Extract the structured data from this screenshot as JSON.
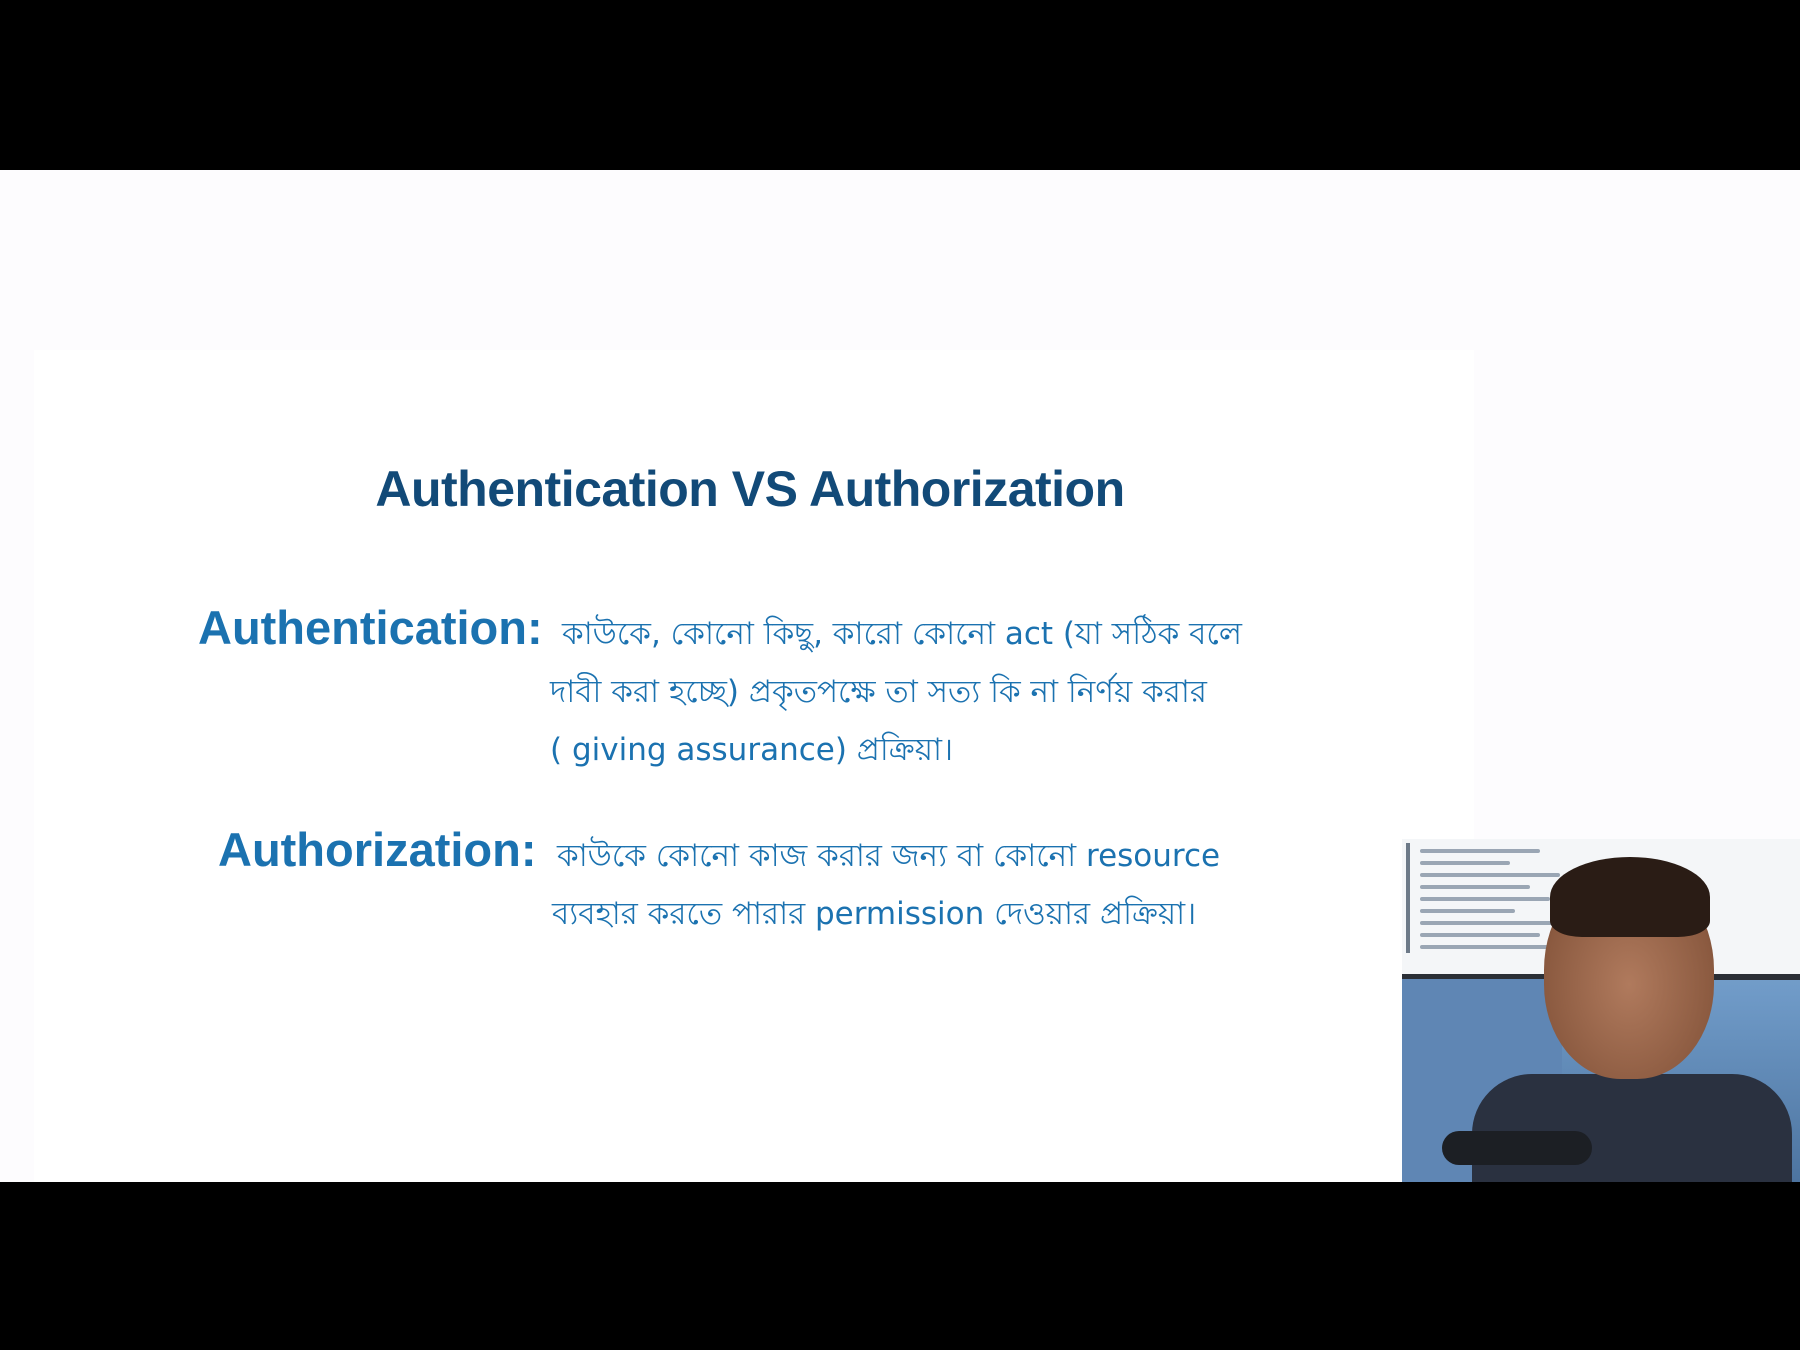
{
  "slide": {
    "title": "Authentication VS Authorization",
    "items": [
      {
        "term": "Authentication:",
        "lines": [
          "কাউকে, কোনো কিছু, কারো কোনো act (যা সঠিক বলে",
          "দাবী করা হচ্ছে) প্রকৃতপক্ষে তা সত্য কি না নির্ণয় করার",
          "( giving assurance) প্রক্রিয়া।"
        ]
      },
      {
        "term": "Authorization:",
        "lines": [
          "কাউকে কোনো কাজ করার জন্য বা কোনো resource",
          "ব্যবহার করতে পারার permission দেওয়ার প্রক্রিয়া।"
        ]
      }
    ]
  },
  "colors": {
    "title": "#124a78",
    "body": "#1b72b0",
    "slide_background": "#ffffff",
    "letterbox": "#000000"
  }
}
